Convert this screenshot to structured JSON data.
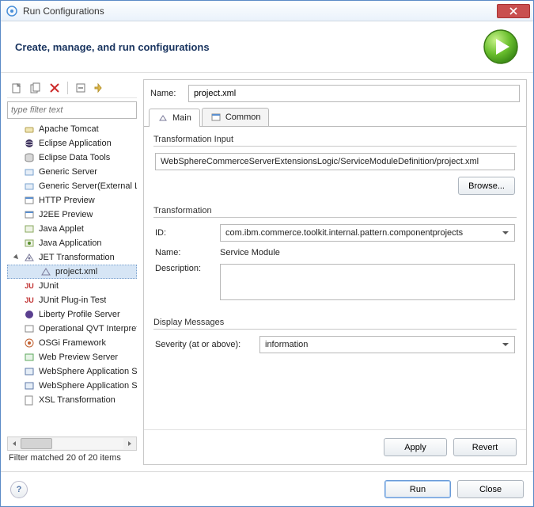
{
  "window": {
    "title": "Run Configurations"
  },
  "banner": {
    "title": "Create, manage, and run configurations"
  },
  "left": {
    "filter_placeholder": "type filter text",
    "status": "Filter matched 20 of 20 items",
    "tree": {
      "items": [
        {
          "label": "Apache Tomcat"
        },
        {
          "label": "Eclipse Application"
        },
        {
          "label": "Eclipse Data Tools"
        },
        {
          "label": "Generic Server"
        },
        {
          "label": "Generic Server(External Launch)"
        },
        {
          "label": "HTTP Preview"
        },
        {
          "label": "J2EE Preview"
        },
        {
          "label": "Java Applet"
        },
        {
          "label": "Java Application"
        },
        {
          "label": "JET Transformation",
          "expanded": true,
          "children": [
            {
              "label": "project.xml",
              "selected": true
            }
          ]
        },
        {
          "label": "JUnit"
        },
        {
          "label": "JUnit Plug-in Test"
        },
        {
          "label": "Liberty Profile Server"
        },
        {
          "label": "Operational QVT Interpreter"
        },
        {
          "label": "OSGi Framework"
        },
        {
          "label": "Web Preview Server"
        },
        {
          "label": "WebSphere Application Server"
        },
        {
          "label": "WebSphere Application Server"
        },
        {
          "label": "XSL Transformation"
        }
      ]
    }
  },
  "right": {
    "name_label": "Name:",
    "name_value": "project.xml",
    "tabs": {
      "main": "Main",
      "common": "Common"
    },
    "transformation_input": {
      "legend": "Transformation Input",
      "value": "WebSphereCommerceServerExtensionsLogic/ServiceModuleDefinition/project.xml",
      "browse": "Browse..."
    },
    "transformation": {
      "legend": "Transformation",
      "id_label": "ID:",
      "id_value": "com.ibm.commerce.toolkit.internal.pattern.componentprojects",
      "name_label": "Name:",
      "name_value": "Service Module",
      "desc_label": "Description:"
    },
    "display_messages": {
      "legend": "Display Messages",
      "severity_label": "Severity (at or above):",
      "severity_value": "information"
    },
    "apply": "Apply",
    "revert": "Revert"
  },
  "footer": {
    "run": "Run",
    "close": "Close"
  }
}
